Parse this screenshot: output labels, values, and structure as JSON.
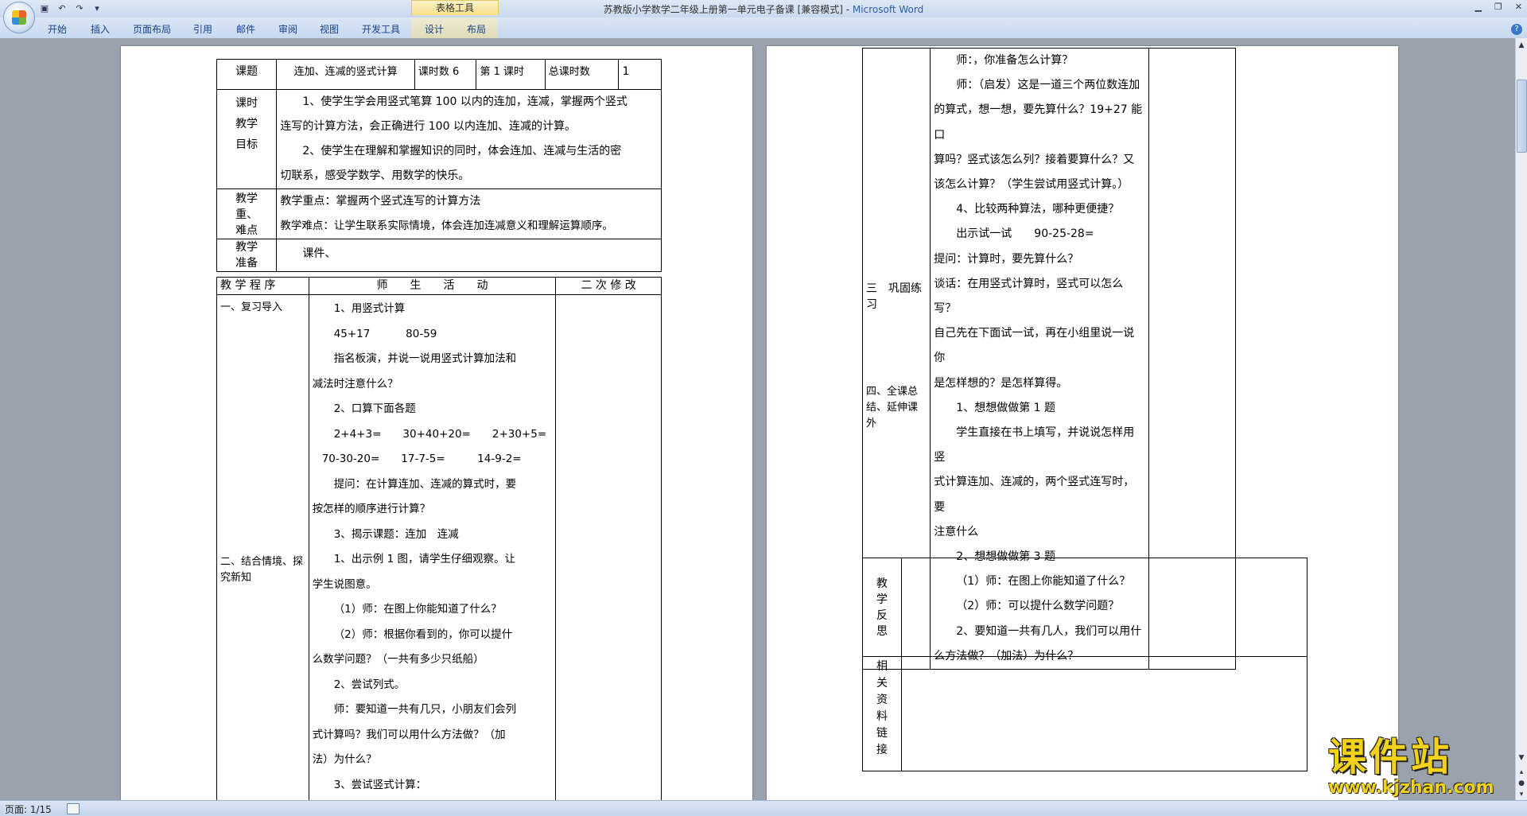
{
  "window": {
    "title": "苏教版小学数学二年级上册第一单元电子备课 [兼容模式] - ",
    "app_name": "Microsoft Word",
    "context_tab_group": "表格工具"
  },
  "ribbon": {
    "tabs": [
      "开始",
      "插入",
      "页面布局",
      "引用",
      "邮件",
      "审阅",
      "视图",
      "开发工具",
      "设计",
      "布局"
    ]
  },
  "status": {
    "page_info": "页面: 1/15"
  },
  "page1": {
    "header": {
      "topic_label": "课题",
      "topic_value": "连加、连减的竖式计算",
      "hours_label": "课时数 6",
      "nth_label": "第 1 课时",
      "total_label": "总课时数",
      "total_value": "1"
    },
    "goals_label": [
      "课时",
      "教学",
      "目标"
    ],
    "goals": [
      "1、使学生学会用竖式笔算 100 以内的连加，连减，掌握两个竖式",
      "连写的计算方法，会正确进行 100 以内连加、连减的计算。",
      "2、使学生在理解和掌握知识的同时，体会连加、连减与生活的密",
      "切联系，感受学数学、用数学的快乐。"
    ],
    "key_label": [
      "教学",
      "重、",
      "难点"
    ],
    "key_points": [
      "教学重点：掌握两个竖式连写的计算方法",
      "教学难点：让学生联系实际情境，体会连加连减意义和理解运算顺序。"
    ],
    "prep_label": [
      "教学",
      "准备"
    ],
    "prep_value": "课件、",
    "process_header": {
      "col1": "教 学 程 序",
      "col2": "师　　生　　活　　动",
      "col3": "二 次 修 改"
    },
    "sections": [
      "一、复习导入",
      "二、结合情境、探究新知"
    ],
    "activities": [
      "1、用竖式计算",
      "45+17　　　 80-59",
      "指名板演，并说一说用竖式计算加法和",
      "减法时注意什么？",
      "2、口算下面各题",
      "2+4+3=　　30+40+20=　　2+30+5=",
      "70-30-20=　　17-7-5=　　　14-9-2=",
      "提问：在计算连加、连减的算式时，要",
      "按怎样的顺序进行计算？",
      "3、揭示课题：连加　连减",
      "1、出示例 1 图，请学生仔细观察。让",
      "学生说图意。",
      "（1）师：在图上你能知道了什么？",
      "（2）师：根据你看到的，你可以提什",
      "么数学问题？（一共有多少只纸船）",
      "2、尝试列式。",
      "师：要知道一共有几只，小朋友们会列",
      "式计算吗？我们可以用什么方法做？（加",
      "法）为什么？",
      "3、尝试竖式计算："
    ]
  },
  "page2": {
    "sections": [
      "三　巩固练习",
      "四、全课总结、延伸课外"
    ],
    "activities": [
      "师：，你准备怎么计算？",
      "师：（启发）这是一道三个两位数连加",
      "的算式，想一想，要先算什么？19+27 能口",
      "算吗？竖式该怎么列？接着要算什么？又",
      "该怎么计算？（学生尝试用竖式计算。）",
      "4、比较两种算法，哪种更便捷？",
      "出示试一试　　90-25-28=",
      "提问：计算时，要先算什么？",
      "谈话：在用竖式计算时，竖式可以怎么写？",
      "自己先在下面试一试，再在小组里说一说你",
      "是怎样想的？是怎样算得。",
      "1、想想做做第 1 题",
      "学生直接在书上填写，并说说怎样用竖",
      "式计算连加、连减的，两个竖式连写时，要",
      "注意什么",
      "2、想想做做第 3 题",
      "（1）师：在图上你能知道了什么？",
      "（2）师：可以提什么数学问题？",
      "2、要知道一共有几人，我们可以用什",
      "么方法做？（加法）为什么？"
    ],
    "reflection_label": [
      "教",
      "学",
      "反",
      "思"
    ],
    "resources_label": [
      "相",
      "关",
      "资",
      "料",
      "链",
      "接"
    ]
  },
  "watermark": {
    "text": "课件站",
    "url": "www.kjzhan.com"
  }
}
